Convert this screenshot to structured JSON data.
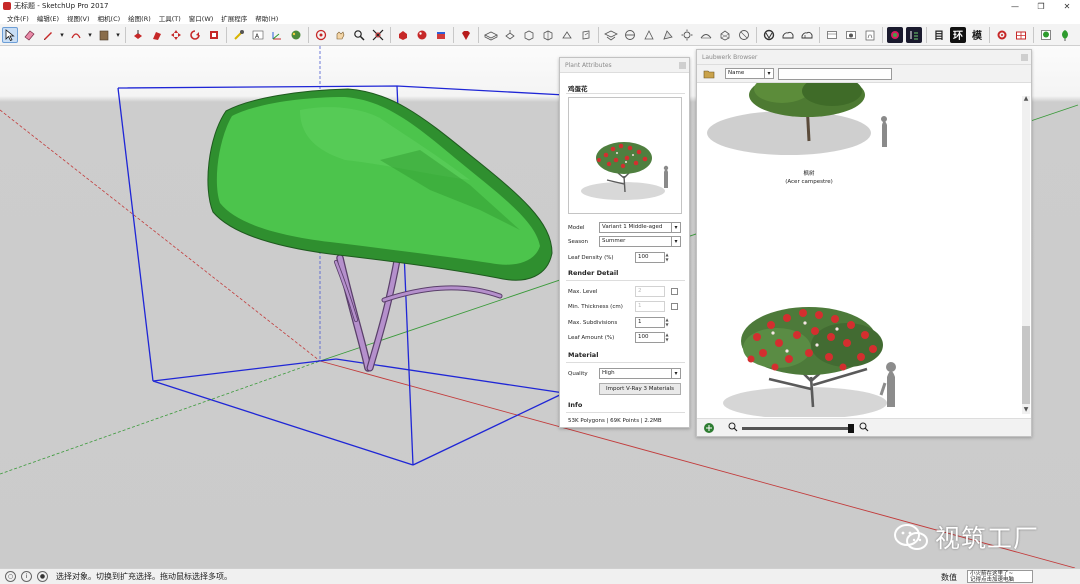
{
  "window": {
    "title": "无标题 - SketchUp Pro 2017",
    "minimize": "—",
    "restore": "❐",
    "close": "✕"
  },
  "menu": [
    "文件(F)",
    "编辑(E)",
    "视图(V)",
    "相机(C)",
    "绘图(R)",
    "工具(T)",
    "窗口(W)",
    "扩展程序",
    "帮助(H)"
  ],
  "toolbar": {
    "tools": [
      "select-arrow-icon",
      "eraser-icon",
      "line-pencil-icon",
      "arc-icon",
      "paint-bucket-icon",
      "push-pull-icon",
      "follow-me-icon",
      "move-icon",
      "rotate-icon",
      "scale-icon",
      "tape-measure-icon",
      "text-icon",
      "axes-icon",
      "orbit-icon",
      "pan-icon",
      "zoom-icon",
      "zoom-extents-icon",
      "component-icon",
      "materials-icon",
      "styles-icon",
      "ruby-icon",
      "iso-view-icon",
      "top-view-icon",
      "front-view-icon",
      "right-view-icon",
      "back-view-icon",
      "left-view-icon",
      "bottom-view-icon",
      "section-plane-icon",
      "section-display-icon",
      "shadow-icon",
      "fog-icon",
      "solid-tools-icon",
      "sandbox-icon",
      "xray-icon",
      "back-edges-icon",
      "wireframe-icon",
      "hidden-line-icon",
      "shaded-icon",
      "textured-icon",
      "monochrome-icon",
      "laubwerk-icon",
      "plant-icon"
    ],
    "glyph_labels": [
      "目",
      "环",
      "模"
    ]
  },
  "plant_panel": {
    "title": "Plant Attributes",
    "plant_name": "鸡蛋花",
    "model_label": "Model",
    "model_value": "Variant 1 Middle-aged",
    "season_label": "Season",
    "season_value": "Summer",
    "leaf_density_label": "Leaf Density (%)",
    "leaf_density_value": "100",
    "render_detail_heading": "Render Detail",
    "max_level_label": "Max. Level",
    "max_level_value": "2",
    "min_thickness_label": "Min. Thickness (cm)",
    "min_thickness_value": "1",
    "max_subdivisions_label": "Max. Subdivisions",
    "max_subdivisions_value": "1",
    "leaf_amount_label": "Leaf Amount (%)",
    "leaf_amount_value": "100",
    "material_heading": "Material",
    "quality_label": "Quality",
    "quality_value": "High",
    "import_button": "Import V-Ray 3 Materials",
    "info_heading": "Info",
    "info_text": "53K Polygons | 69K Points | 2.2MB"
  },
  "laub_panel": {
    "title": "Laubwerk Browser",
    "filter_value": "Name",
    "search_value": "",
    "items": [
      {
        "name": "枫树",
        "latin": "(Acer campestre)"
      }
    ]
  },
  "status": {
    "hint": "选择对象。切换到扩充选择。拖动鼠标选择多项。",
    "measure_label": "数值",
    "notice_line1": "小火箭在这里了~",
    "notice_line2": "记得点击加速电脑"
  },
  "watermark": {
    "text": "视筑工厂"
  },
  "colors": {
    "bounding_box": "#1f26d6",
    "canopy": "#3fbf3f",
    "trunk": "#a07ab8",
    "green_axis": "#3a9a3a",
    "red_axis": "#c23c3c",
    "blue_axis": "#4a5ad0"
  }
}
